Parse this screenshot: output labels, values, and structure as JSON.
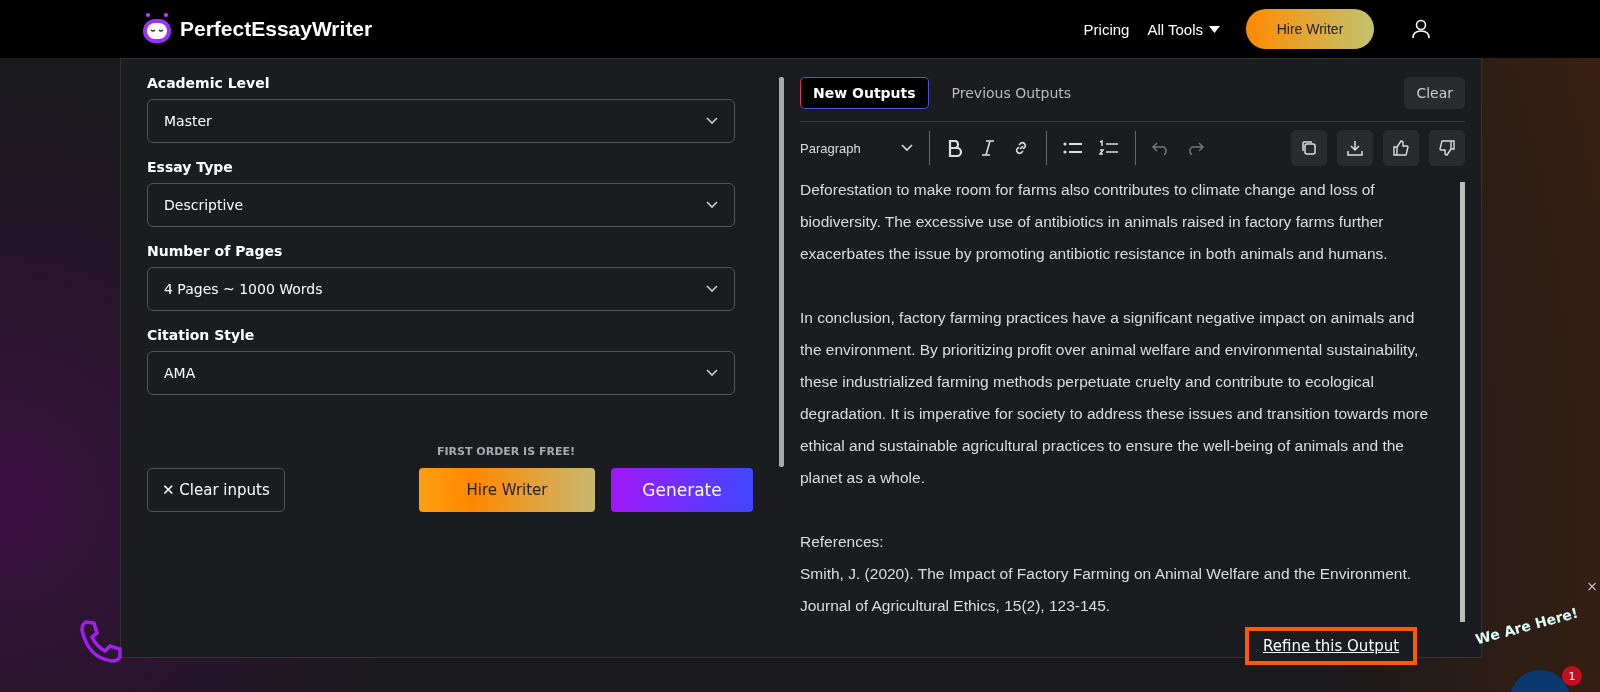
{
  "nav": {
    "brand": "PerfectEssayWriter",
    "links": [
      {
        "label": "Pricing",
        "kind": "link"
      },
      {
        "label": "All Tools",
        "kind": "dropdown"
      }
    ],
    "hire_button": "Hire Writer"
  },
  "form": {
    "fields": [
      {
        "label": "Academic Level",
        "value": "Master"
      },
      {
        "label": "Essay Type",
        "value": "Descriptive"
      },
      {
        "label": "Number of Pages",
        "value": "4 Pages ~ 1000 Words"
      },
      {
        "label": "Citation Style",
        "value": "AMA"
      }
    ],
    "promo": "FIRST ORDER IS FREE!",
    "clear_button": "✕ Clear inputs",
    "hire_button": "Hire Writer",
    "generate_button": "Generate"
  },
  "output": {
    "tabs": [
      {
        "label": "New Outputs",
        "selected": true
      },
      {
        "label": "Previous Outputs",
        "selected": false
      }
    ],
    "clear_button": "Clear",
    "block_style": "Paragraph",
    "paragraphs": [
      "Deforestation to make room for farms also contributes to climate change and loss of biodiversity. The excessive use of antibiotics in animals raised in factory farms further exacerbates the issue by promoting antibiotic resistance in both animals and humans.",
      "In conclusion, factory farming practices have a significant negative impact on animals and the environment. By prioritizing profit over animal welfare and environmental sustainability, these industrialized farming methods perpetuate cruelty and contribute to ecological degradation. It is imperative for society to address these issues and transition towards more ethical and sustainable agricultural practices to ensure the well-being of animals and the planet as a whole.",
      "References:",
      "Smith, J. (2020). The Impact of Factory Farming on Animal Welfare and the Environment. Journal of Agricultural Ethics, 15(2), 123-145."
    ],
    "refine_link": "Refine this Output"
  },
  "chat_widget": {
    "title": "We Are Here!",
    "badge": "1",
    "close": "×"
  }
}
